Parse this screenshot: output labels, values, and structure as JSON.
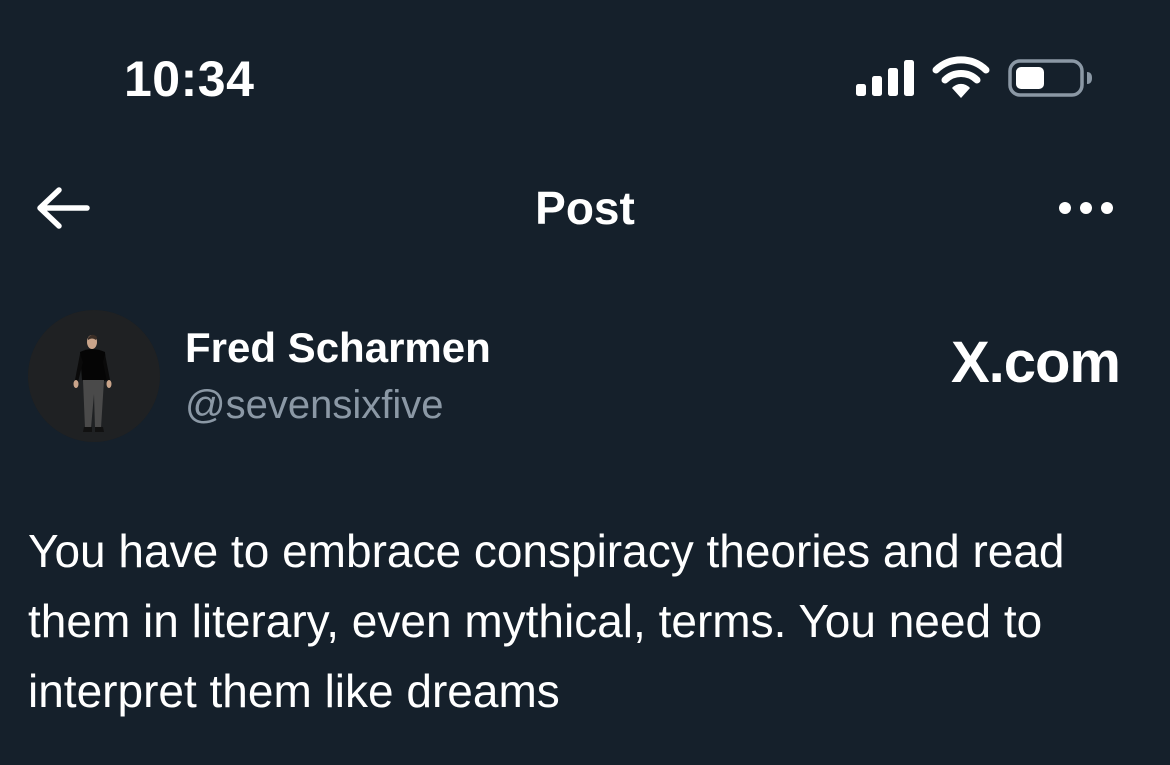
{
  "status_bar": {
    "time": "10:34",
    "signal_icon": "cellular-signal-icon",
    "wifi_icon": "wifi-icon",
    "battery_icon": "battery-icon",
    "battery_level": 0.45
  },
  "header": {
    "back_icon": "arrow-left-icon",
    "title": "Post",
    "more_icon": "more-horizontal-icon"
  },
  "post": {
    "author": {
      "name": "Fred Scharmen",
      "handle": "@sevensixfive"
    },
    "brand": "X.com",
    "text": "You have to embrace conspiracy theories and read them in literary, even mythical, terms. You need to interpret them like dreams"
  },
  "colors": {
    "background": "#15202b",
    "text_primary": "#ffffff",
    "text_secondary": "#8b98a5"
  }
}
